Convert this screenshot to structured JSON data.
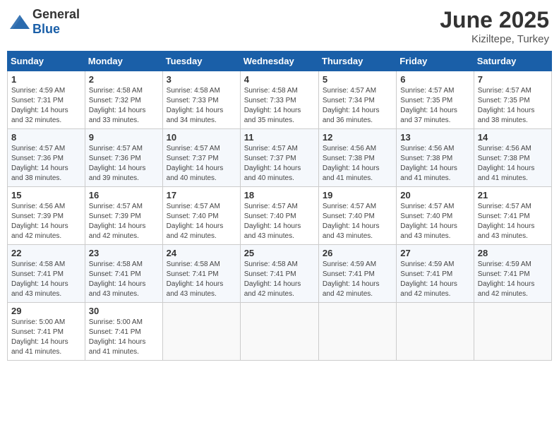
{
  "header": {
    "logo_general": "General",
    "logo_blue": "Blue",
    "month_year": "June 2025",
    "location": "Kiziltepe, Turkey"
  },
  "days_of_week": [
    "Sunday",
    "Monday",
    "Tuesday",
    "Wednesday",
    "Thursday",
    "Friday",
    "Saturday"
  ],
  "weeks": [
    [
      {
        "day": "1",
        "info": "Sunrise: 4:59 AM\nSunset: 7:31 PM\nDaylight: 14 hours\nand 32 minutes."
      },
      {
        "day": "2",
        "info": "Sunrise: 4:58 AM\nSunset: 7:32 PM\nDaylight: 14 hours\nand 33 minutes."
      },
      {
        "day": "3",
        "info": "Sunrise: 4:58 AM\nSunset: 7:33 PM\nDaylight: 14 hours\nand 34 minutes."
      },
      {
        "day": "4",
        "info": "Sunrise: 4:58 AM\nSunset: 7:33 PM\nDaylight: 14 hours\nand 35 minutes."
      },
      {
        "day": "5",
        "info": "Sunrise: 4:57 AM\nSunset: 7:34 PM\nDaylight: 14 hours\nand 36 minutes."
      },
      {
        "day": "6",
        "info": "Sunrise: 4:57 AM\nSunset: 7:35 PM\nDaylight: 14 hours\nand 37 minutes."
      },
      {
        "day": "7",
        "info": "Sunrise: 4:57 AM\nSunset: 7:35 PM\nDaylight: 14 hours\nand 38 minutes."
      }
    ],
    [
      {
        "day": "8",
        "info": "Sunrise: 4:57 AM\nSunset: 7:36 PM\nDaylight: 14 hours\nand 38 minutes."
      },
      {
        "day": "9",
        "info": "Sunrise: 4:57 AM\nSunset: 7:36 PM\nDaylight: 14 hours\nand 39 minutes."
      },
      {
        "day": "10",
        "info": "Sunrise: 4:57 AM\nSunset: 7:37 PM\nDaylight: 14 hours\nand 40 minutes."
      },
      {
        "day": "11",
        "info": "Sunrise: 4:57 AM\nSunset: 7:37 PM\nDaylight: 14 hours\nand 40 minutes."
      },
      {
        "day": "12",
        "info": "Sunrise: 4:56 AM\nSunset: 7:38 PM\nDaylight: 14 hours\nand 41 minutes."
      },
      {
        "day": "13",
        "info": "Sunrise: 4:56 AM\nSunset: 7:38 PM\nDaylight: 14 hours\nand 41 minutes."
      },
      {
        "day": "14",
        "info": "Sunrise: 4:56 AM\nSunset: 7:38 PM\nDaylight: 14 hours\nand 41 minutes."
      }
    ],
    [
      {
        "day": "15",
        "info": "Sunrise: 4:56 AM\nSunset: 7:39 PM\nDaylight: 14 hours\nand 42 minutes."
      },
      {
        "day": "16",
        "info": "Sunrise: 4:57 AM\nSunset: 7:39 PM\nDaylight: 14 hours\nand 42 minutes."
      },
      {
        "day": "17",
        "info": "Sunrise: 4:57 AM\nSunset: 7:40 PM\nDaylight: 14 hours\nand 42 minutes."
      },
      {
        "day": "18",
        "info": "Sunrise: 4:57 AM\nSunset: 7:40 PM\nDaylight: 14 hours\nand 43 minutes."
      },
      {
        "day": "19",
        "info": "Sunrise: 4:57 AM\nSunset: 7:40 PM\nDaylight: 14 hours\nand 43 minutes."
      },
      {
        "day": "20",
        "info": "Sunrise: 4:57 AM\nSunset: 7:40 PM\nDaylight: 14 hours\nand 43 minutes."
      },
      {
        "day": "21",
        "info": "Sunrise: 4:57 AM\nSunset: 7:41 PM\nDaylight: 14 hours\nand 43 minutes."
      }
    ],
    [
      {
        "day": "22",
        "info": "Sunrise: 4:58 AM\nSunset: 7:41 PM\nDaylight: 14 hours\nand 43 minutes."
      },
      {
        "day": "23",
        "info": "Sunrise: 4:58 AM\nSunset: 7:41 PM\nDaylight: 14 hours\nand 43 minutes."
      },
      {
        "day": "24",
        "info": "Sunrise: 4:58 AM\nSunset: 7:41 PM\nDaylight: 14 hours\nand 43 minutes."
      },
      {
        "day": "25",
        "info": "Sunrise: 4:58 AM\nSunset: 7:41 PM\nDaylight: 14 hours\nand 42 minutes."
      },
      {
        "day": "26",
        "info": "Sunrise: 4:59 AM\nSunset: 7:41 PM\nDaylight: 14 hours\nand 42 minutes."
      },
      {
        "day": "27",
        "info": "Sunrise: 4:59 AM\nSunset: 7:41 PM\nDaylight: 14 hours\nand 42 minutes."
      },
      {
        "day": "28",
        "info": "Sunrise: 4:59 AM\nSunset: 7:41 PM\nDaylight: 14 hours\nand 42 minutes."
      }
    ],
    [
      {
        "day": "29",
        "info": "Sunrise: 5:00 AM\nSunset: 7:41 PM\nDaylight: 14 hours\nand 41 minutes."
      },
      {
        "day": "30",
        "info": "Sunrise: 5:00 AM\nSunset: 7:41 PM\nDaylight: 14 hours\nand 41 minutes."
      },
      {
        "day": "",
        "info": ""
      },
      {
        "day": "",
        "info": ""
      },
      {
        "day": "",
        "info": ""
      },
      {
        "day": "",
        "info": ""
      },
      {
        "day": "",
        "info": ""
      }
    ]
  ]
}
